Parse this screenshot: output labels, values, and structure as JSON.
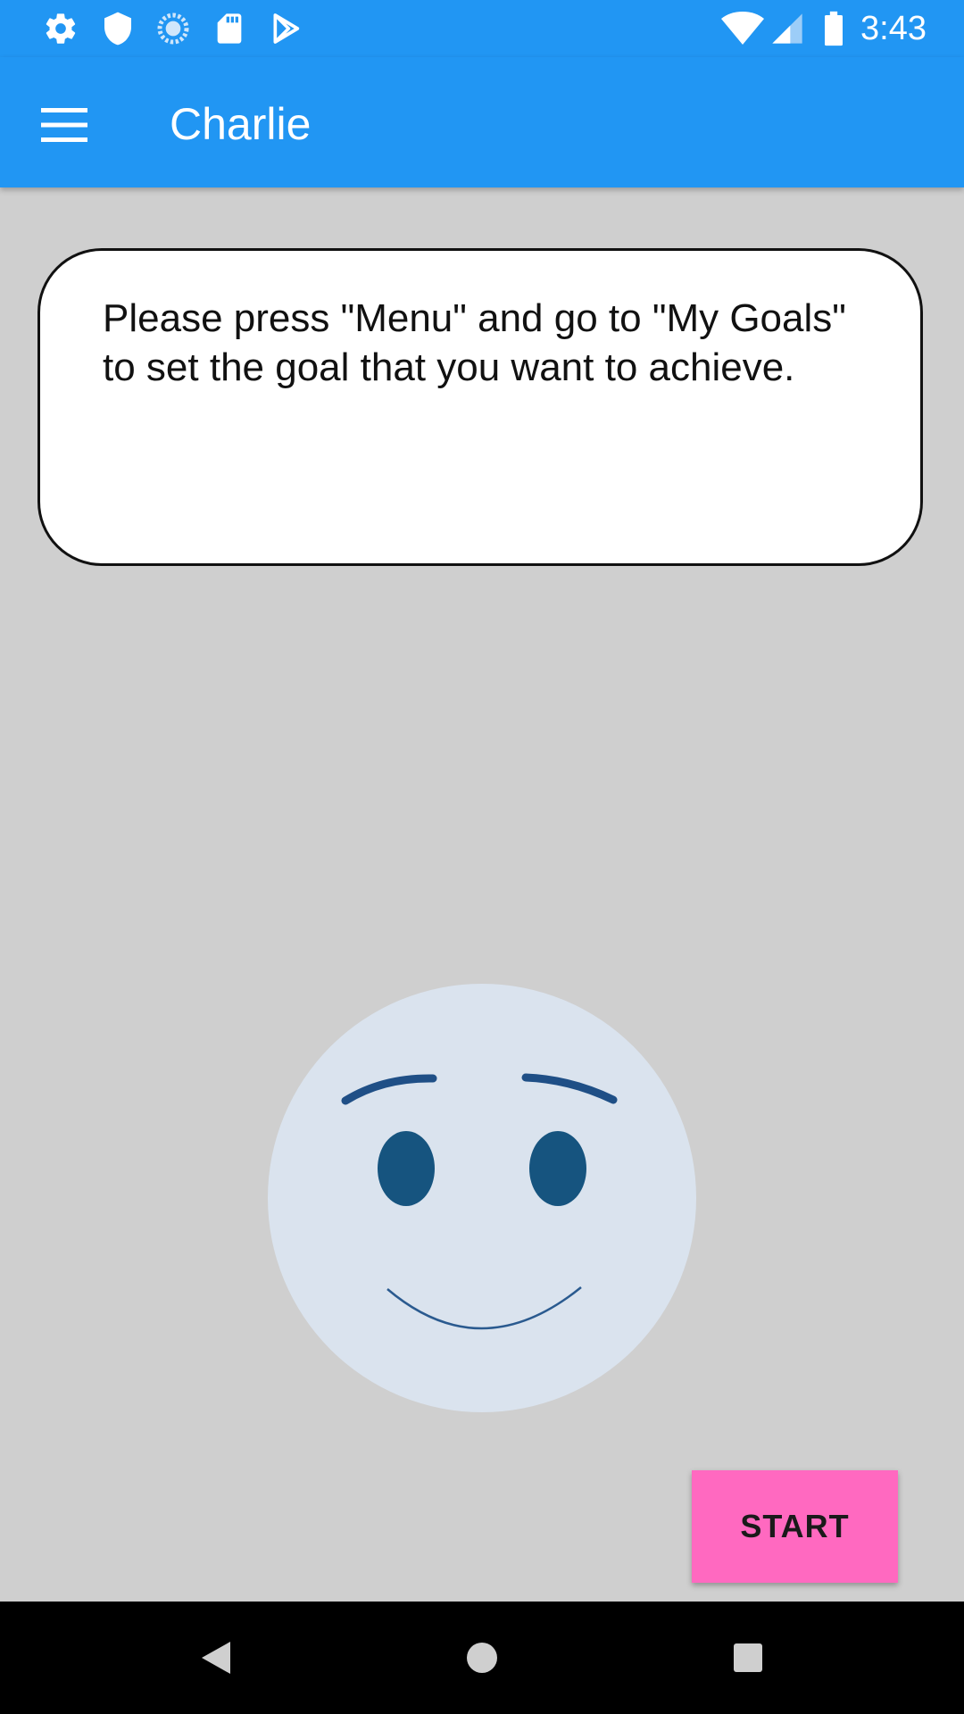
{
  "status_bar": {
    "time": "3:43",
    "icons": [
      "settings-icon",
      "shield-icon",
      "sync-icon",
      "sd-card-icon",
      "play-store-icon",
      "wifi-icon",
      "signal-icon",
      "battery-icon"
    ]
  },
  "app_bar": {
    "title": "Charlie",
    "menu_icon": "hamburger-menu-icon"
  },
  "message": {
    "text": "Please press \"Menu\" and go to \"My Goals\" to set the goal that you want to achieve."
  },
  "face": {
    "expression": "smile",
    "face_color": "#dae3ee",
    "feature_color": "#16547f"
  },
  "start_button": {
    "label": "START",
    "color": "#ff69c0"
  },
  "nav_bar": {
    "icons": [
      "back-icon",
      "home-icon",
      "recents-icon"
    ]
  },
  "colors": {
    "primary": "#2196f3",
    "background": "#cfcfcf"
  }
}
